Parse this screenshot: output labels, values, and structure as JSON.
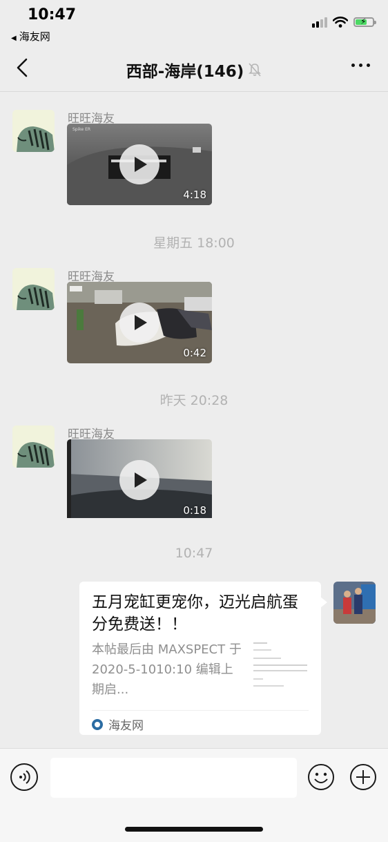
{
  "status_bar": {
    "time": "10:47",
    "back_app_label": "海友网",
    "signal_icon": "cellular-signal-icon",
    "wifi_icon": "wifi-icon",
    "battery_icon": "battery-charging-icon",
    "battery_color": "#4cd964"
  },
  "nav": {
    "back_icon": "chevron-left-icon",
    "title": "西部-海岸(146)",
    "mute_icon": "bell-muted-icon",
    "more_icon": "more-dots-icon"
  },
  "messages": [
    {
      "sender": "旺旺海友",
      "type": "video",
      "duration": "4:18"
    },
    {
      "timestamp": "星期五 18:00"
    },
    {
      "sender": "旺旺海友",
      "type": "video",
      "duration": "0:42"
    },
    {
      "timestamp": "昨天 20:28"
    },
    {
      "sender": "旺旺海友",
      "type": "video",
      "duration": "0:18"
    },
    {
      "timestamp": "10:47"
    }
  ],
  "link_card": {
    "title": "五月宠缸更宠你，迈光启航蛋分免费送！！",
    "description": "本帖最后由 MAXSPECT 于 2020-5-1010:10 编辑上期启...",
    "source_name": "海友网",
    "source_icon": "haiyou-logo-icon"
  },
  "input_bar": {
    "voice_icon": "voice-icon",
    "input_value": "",
    "emoji_icon": "emoji-icon",
    "plus_icon": "plus-icon"
  },
  "colors": {
    "background": "#ededed",
    "bubble": "#ffffff",
    "timestamp_text": "#b2b2b2",
    "sender_text": "#8a8a8a"
  }
}
